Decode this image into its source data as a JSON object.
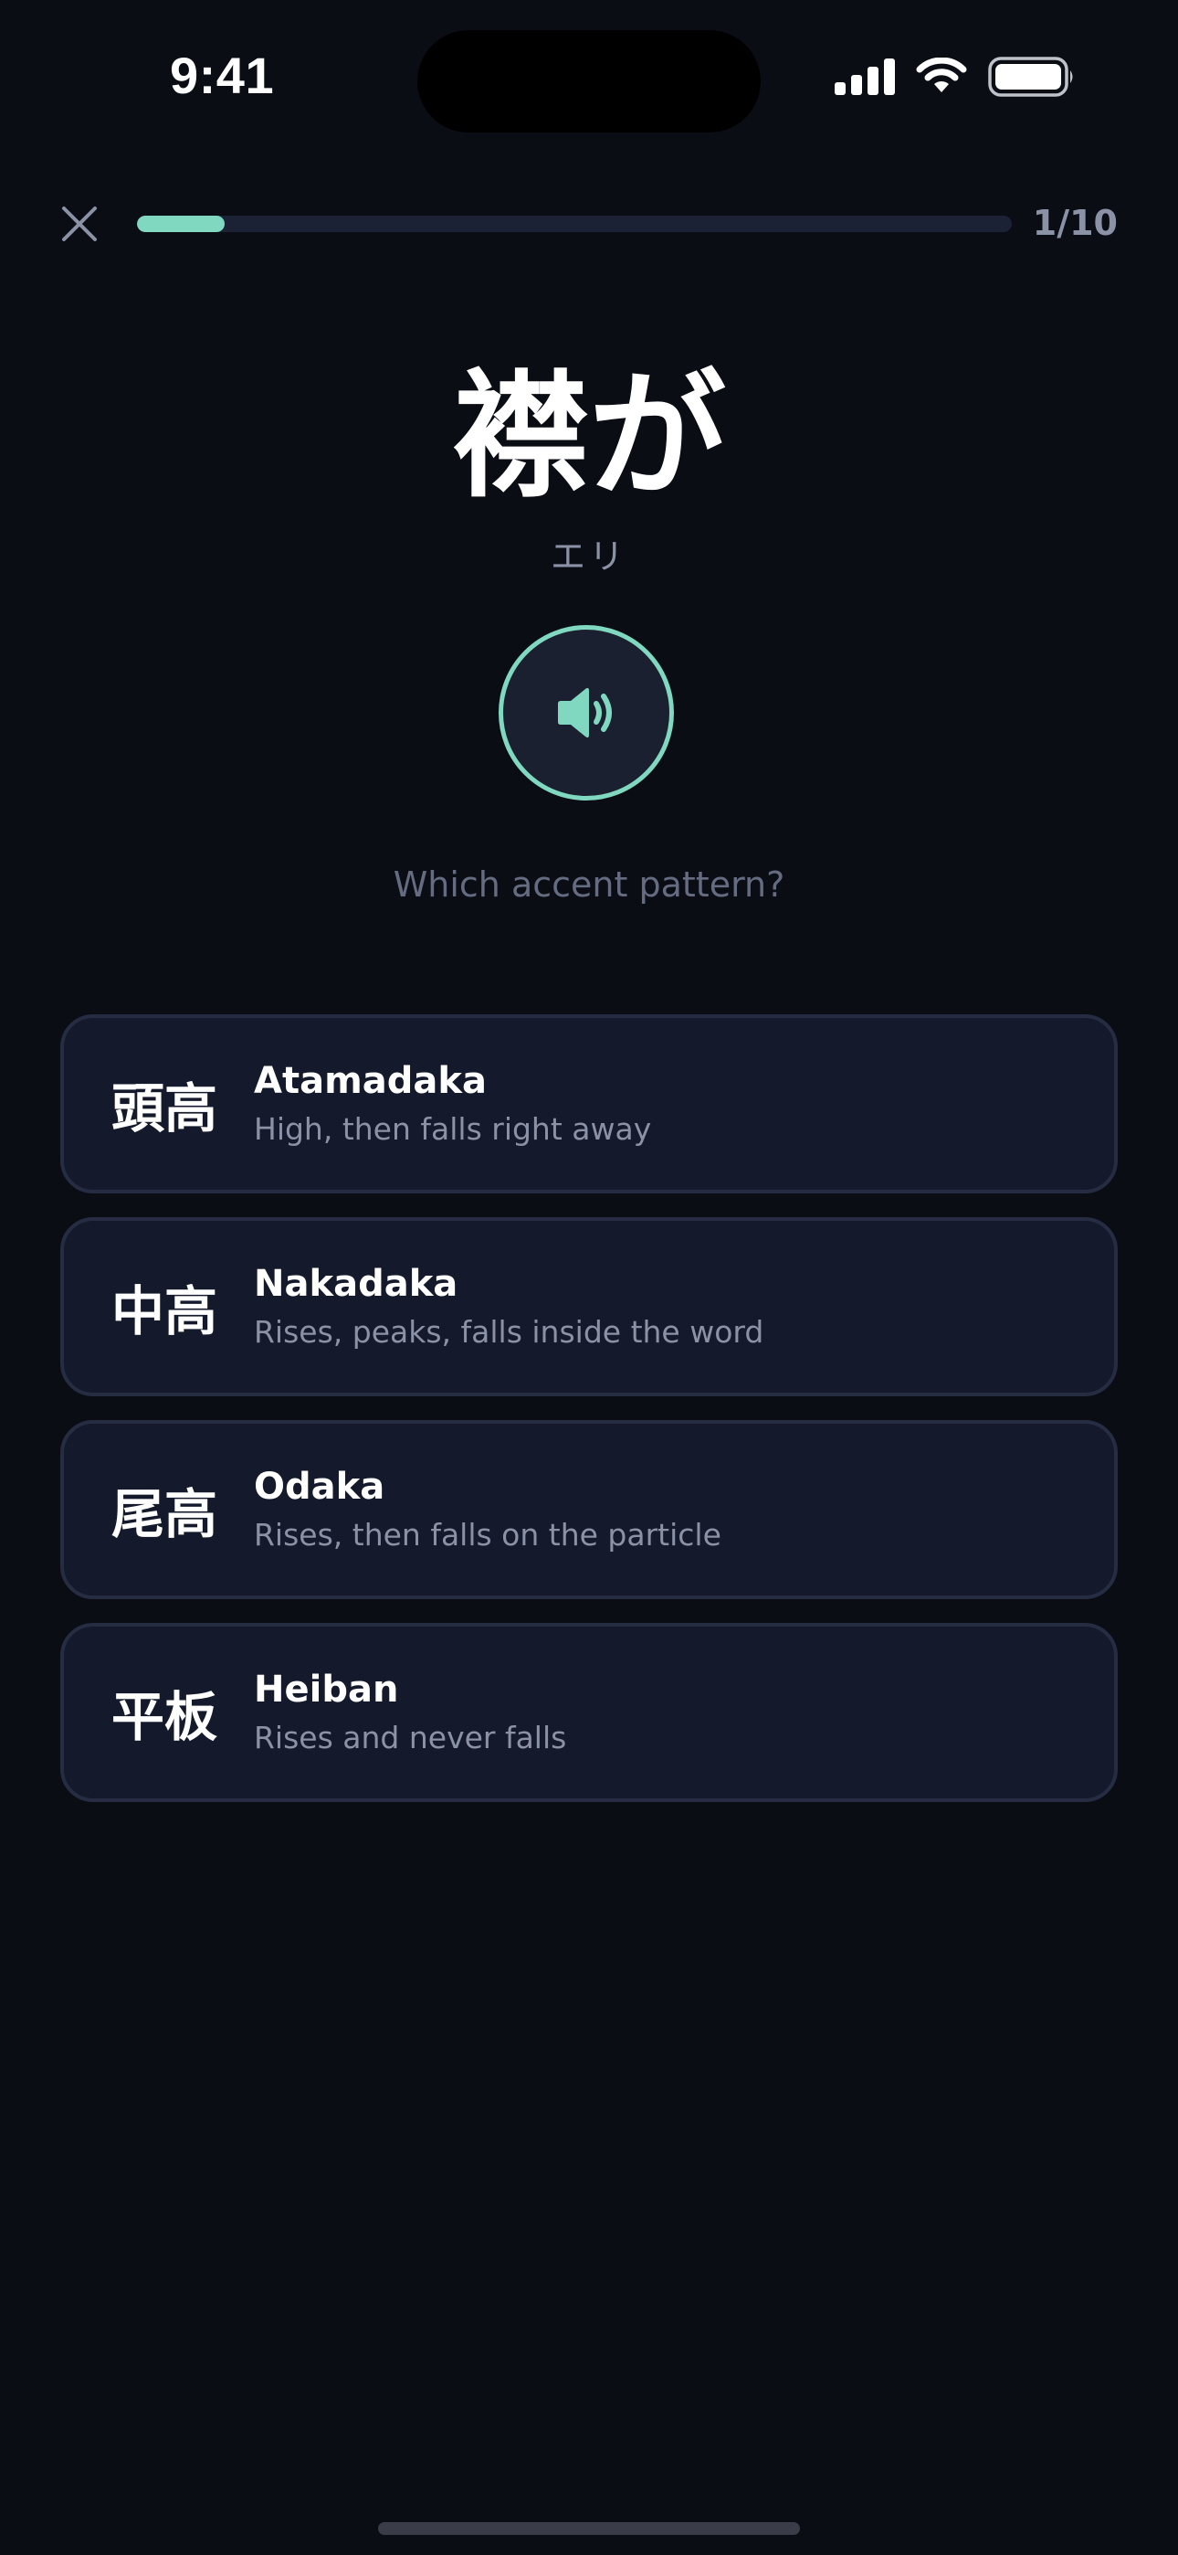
{
  "status_bar": {
    "time": "9:41",
    "icons": [
      "cellular-signal-icon",
      "wifi-icon",
      "battery-icon"
    ]
  },
  "header": {
    "close_icon": "close-icon",
    "progress_fraction": 0.1,
    "progress_count": "1/10"
  },
  "question": {
    "word": "襟が",
    "reading": "エリ",
    "play_icon": "speaker-icon",
    "prompt": "Which accent pattern?"
  },
  "options": [
    {
      "kanji": "頭高",
      "title": "Atamadaka",
      "description": "High, then falls right away"
    },
    {
      "kanji": "中高",
      "title": "Nakadaka",
      "description": "Rises, peaks, falls inside the word"
    },
    {
      "kanji": "尾高",
      "title": "Odaka",
      "description": "Rises, then falls on the particle"
    },
    {
      "kanji": "平板",
      "title": "Heiban",
      "description": "Rises and never falls"
    }
  ],
  "colors": {
    "background": "#0b0d15",
    "accent": "#7fd8bf",
    "card": "#141a2b",
    "card_border": "#262c42",
    "muted_text": "#8c92a6"
  }
}
